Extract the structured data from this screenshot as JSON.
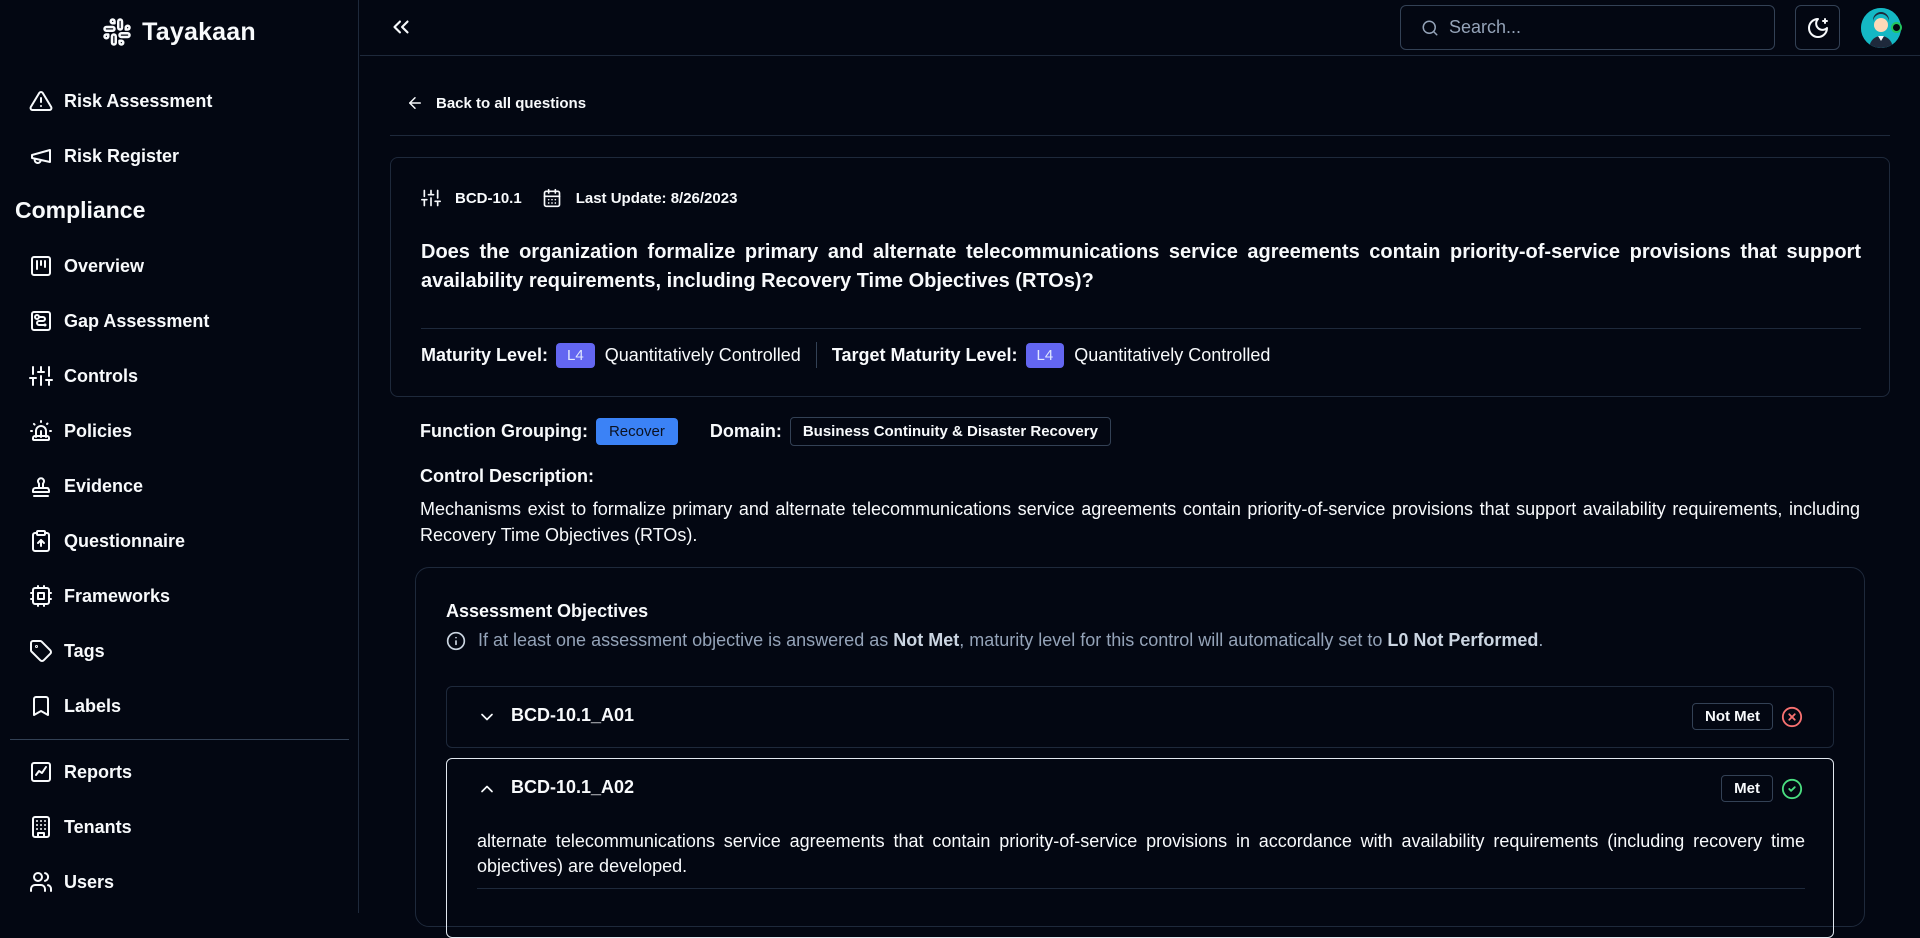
{
  "brand": {
    "name": "Tayakaan"
  },
  "sidebar": {
    "top_items": [
      {
        "label": "Risk Assessment",
        "icon": "warning-icon"
      },
      {
        "label": "Risk Register",
        "icon": "megaphone-icon"
      }
    ],
    "section_title": "Compliance",
    "compliance_items": [
      {
        "label": "Overview",
        "icon": "overview-icon"
      },
      {
        "label": "Gap Assessment",
        "icon": "gap-assessment-icon"
      },
      {
        "label": "Controls",
        "icon": "sliders-icon"
      },
      {
        "label": "Policies",
        "icon": "siren-icon"
      },
      {
        "label": "Evidence",
        "icon": "stamp-icon"
      },
      {
        "label": "Questionnaire",
        "icon": "clipboard-icon"
      },
      {
        "label": "Frameworks",
        "icon": "chip-icon"
      },
      {
        "label": "Tags",
        "icon": "tag-icon"
      },
      {
        "label": "Labels",
        "icon": "bookmark-icon"
      }
    ],
    "bottom_items": [
      {
        "label": "Reports",
        "icon": "chart-file-icon"
      },
      {
        "label": "Tenants",
        "icon": "building-icon"
      },
      {
        "label": "Users",
        "icon": "users-icon"
      }
    ]
  },
  "topbar": {
    "search_placeholder": "Search..."
  },
  "page": {
    "back_label": "Back to all questions",
    "control_id": "BCD-10.1",
    "last_update": "Last Update: 8/26/2023",
    "question": "Does the organization formalize primary and alternate telecommunications service agreements contain priority-of-service provisions that support availability requirements, including Recovery Time Objectives (RTOs)?",
    "maturity_label": "Maturity Level:",
    "maturity_badge": "L4",
    "maturity_value": "Quantitatively Controlled",
    "target_label": "Target Maturity Level:",
    "target_badge": "L4",
    "target_value": "Quantitatively Controlled",
    "function_label": "Function Grouping:",
    "function_value": "Recover",
    "domain_label": "Domain:",
    "domain_value": "Business Continuity & Disaster Recovery",
    "control_desc_label": "Control Description:",
    "control_desc": "Mechanisms exist to formalize primary and alternate telecommunications service agreements contain priority-of-service provisions that support availability requirements, including Recovery Time Objectives (RTOs).",
    "ao_title": "Assessment Objectives",
    "ao_note_pre": "If at least one assessment objective is answered as ",
    "ao_note_b1": "Not Met",
    "ao_note_mid": ", maturity level for this control will automatically set to ",
    "ao_note_b2": "L0 Not Performed",
    "ao_note_end": ".",
    "objectives": [
      {
        "code": "BCD-10.1_A01",
        "status": "Not Met",
        "status_color": "#f87171",
        "open": false,
        "body": ""
      },
      {
        "code": "BCD-10.1_A02",
        "status": "Met",
        "status_color": "#4ade80",
        "open": true,
        "body": "alternate telecommunications service agreements that contain priority-of-service provisions in accordance with availability requirements (including recovery time objectives) are developed."
      }
    ]
  },
  "colors": {
    "accent": "#6366f1",
    "recover": "#3b82f6",
    "bg": "#030712"
  }
}
